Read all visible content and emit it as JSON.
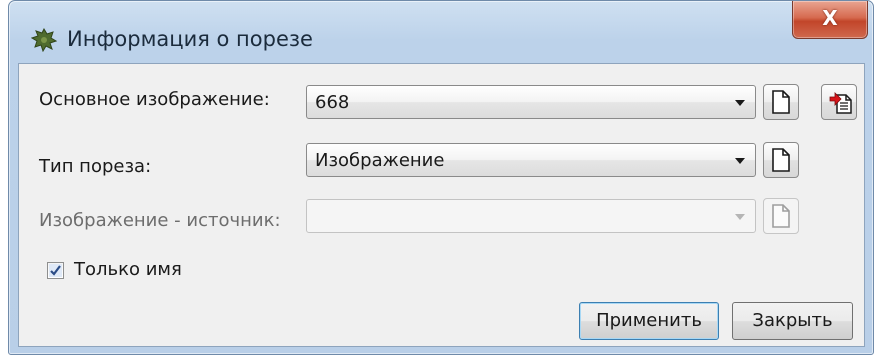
{
  "window": {
    "title": "Информация о порезе",
    "close_label": "X"
  },
  "form": {
    "main_image": {
      "label": "Основное изображение:",
      "value": "668"
    },
    "cut_type": {
      "label": "Тип пореза:",
      "value": "Изображение"
    },
    "source_image": {
      "label": "Изображение - источник:",
      "value": "",
      "enabled": false
    },
    "name_only": {
      "label": "Только имя",
      "checked": true
    }
  },
  "buttons": {
    "apply_label": "Применить",
    "close_label": "Закрыть"
  },
  "icons": {
    "app": "puzzle-leaf-icon",
    "new_document": "blank-document-icon",
    "paste_document": "paste-red-arrow-document-icon"
  },
  "colors": {
    "titlebar": "#bcd2ea",
    "close_button": "#c2452a",
    "client_background": "#f0f0f0",
    "default_button_border": "#3c7fb1"
  }
}
